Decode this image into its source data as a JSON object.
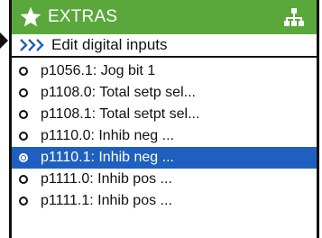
{
  "header": {
    "title": "EXTRAS",
    "left_icon": "star-icon",
    "right_icon": "tree-icon",
    "color": "#5aa83c"
  },
  "subheader": {
    "icon": "double-chevron-right-icon",
    "title": "Edit digital inputs"
  },
  "list": {
    "selected_color": "#1f5fbf",
    "items": [
      {
        "label": "p1056.1: Jog bit 1",
        "selected": false
      },
      {
        "label": "p1108.0: Total setp sel...",
        "selected": false
      },
      {
        "label": "p1108.1: Total setpt sel...",
        "selected": false
      },
      {
        "label": "p1110.0: Inhib neg ...",
        "selected": false
      },
      {
        "label": "p1110.1: Inhib neg ...",
        "selected": true
      },
      {
        "label": "p1111.0: Inhib pos ...",
        "selected": false
      },
      {
        "label": "p1111.1: Inhib pos ...",
        "selected": false
      }
    ]
  }
}
